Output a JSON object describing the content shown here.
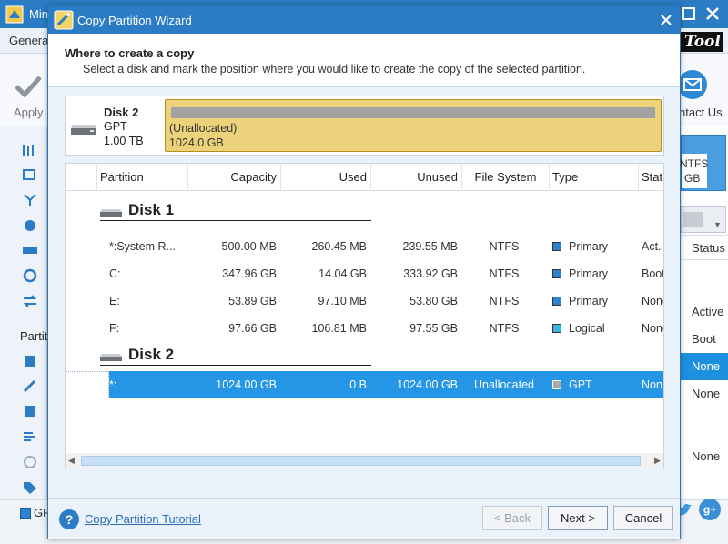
{
  "background_window": {
    "title": "Mini",
    "menu_general": "Genera",
    "logo_text": "Tool",
    "apply_label": "Apply",
    "contact_label": "ntact Us",
    "partition_heading": "Partiti",
    "right_disk_fs": "NTFS",
    "right_disk_size": "GB",
    "status_header": "Status",
    "status_values": [
      "Active",
      "Boot",
      "None",
      "None",
      "None"
    ],
    "legend_label": "GP",
    "accent": "#2b7cc4"
  },
  "dialog": {
    "title": "Copy Partition Wizard",
    "heading": "Where to create a copy",
    "subheading": "Select a disk and mark the position where you would like to create the copy of the selected partition.",
    "disk_card": {
      "name": "Disk 2",
      "type": "GPT",
      "size": "1.00 TB",
      "unallocated_label": "(Unallocated)",
      "unallocated_size": "1024.0 GB"
    },
    "table": {
      "columns": [
        "Partition",
        "Capacity",
        "Used",
        "Unused",
        "File System",
        "Type",
        "Stat"
      ],
      "groups": [
        {
          "label": "Disk 1",
          "rows": [
            {
              "partition": "*:System R...",
              "capacity": "500.00 MB",
              "used": "260.45 MB",
              "unused": "239.55 MB",
              "fs": "NTFS",
              "type": "Primary",
              "status": "Act.",
              "swatch": "#2d83cf"
            },
            {
              "partition": "C:",
              "capacity": "347.96 GB",
              "used": "14.04 GB",
              "unused": "333.92 GB",
              "fs": "NTFS",
              "type": "Primary",
              "status": "Boot",
              "swatch": "#2d83cf"
            },
            {
              "partition": "E:",
              "capacity": "53.89 GB",
              "used": "97.10 MB",
              "unused": "53.80 GB",
              "fs": "NTFS",
              "type": "Primary",
              "status": "None",
              "swatch": "#2d83cf"
            },
            {
              "partition": "F:",
              "capacity": "97.66 GB",
              "used": "106.81 MB",
              "unused": "97.55 GB",
              "fs": "NTFS",
              "type": "Logical",
              "status": "None",
              "swatch": "#3cb4e0"
            }
          ]
        },
        {
          "label": "Disk 2",
          "rows": [
            {
              "partition": "*:",
              "capacity": "1024.00 GB",
              "used": "0 B",
              "unused": "1024.00 GB",
              "fs": "Unallocated",
              "type": "GPT",
              "status": "Non",
              "swatch": "#a9a9a9",
              "selected": true
            }
          ]
        }
      ]
    },
    "footer": {
      "tutorial_link": "Copy Partition Tutorial",
      "back_label": "< Back",
      "next_label": "Next >",
      "cancel_label": "Cancel"
    }
  },
  "colors": {
    "titlebar": "#2b7cc4",
    "selection": "#2596e5",
    "unallocated": "#ecd27a",
    "primary_swatch": "#2d83cf",
    "logical_swatch": "#3cb4e0"
  }
}
